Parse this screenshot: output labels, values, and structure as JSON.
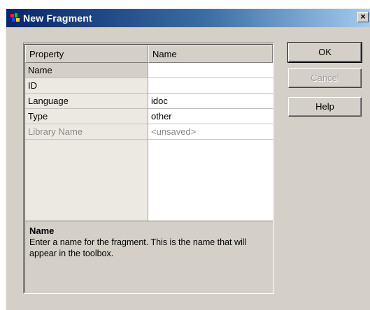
{
  "window": {
    "title": "New Fragment",
    "close_glyph": "×",
    "title_icon": "fragment-app-icon"
  },
  "grid": {
    "headers": [
      "Property",
      "Name"
    ],
    "rows": [
      {
        "property": "Name",
        "value": ""
      },
      {
        "property": "ID",
        "value": ""
      },
      {
        "property": "Language",
        "value": "idoc"
      },
      {
        "property": "Type",
        "value": "other"
      },
      {
        "property": "Library Name",
        "value": "<unsaved>"
      }
    ]
  },
  "description": {
    "title": "Name",
    "text": "Enter a name for the fragment.  This is the name that will appear in the toolbox."
  },
  "buttons": {
    "ok": "OK",
    "cancel": "Cancel",
    "help": "Help"
  },
  "colors": {
    "titlebar_start": "#0a246a",
    "titlebar_end": "#a6caf0",
    "dialog_face": "#d4d0c8"
  }
}
